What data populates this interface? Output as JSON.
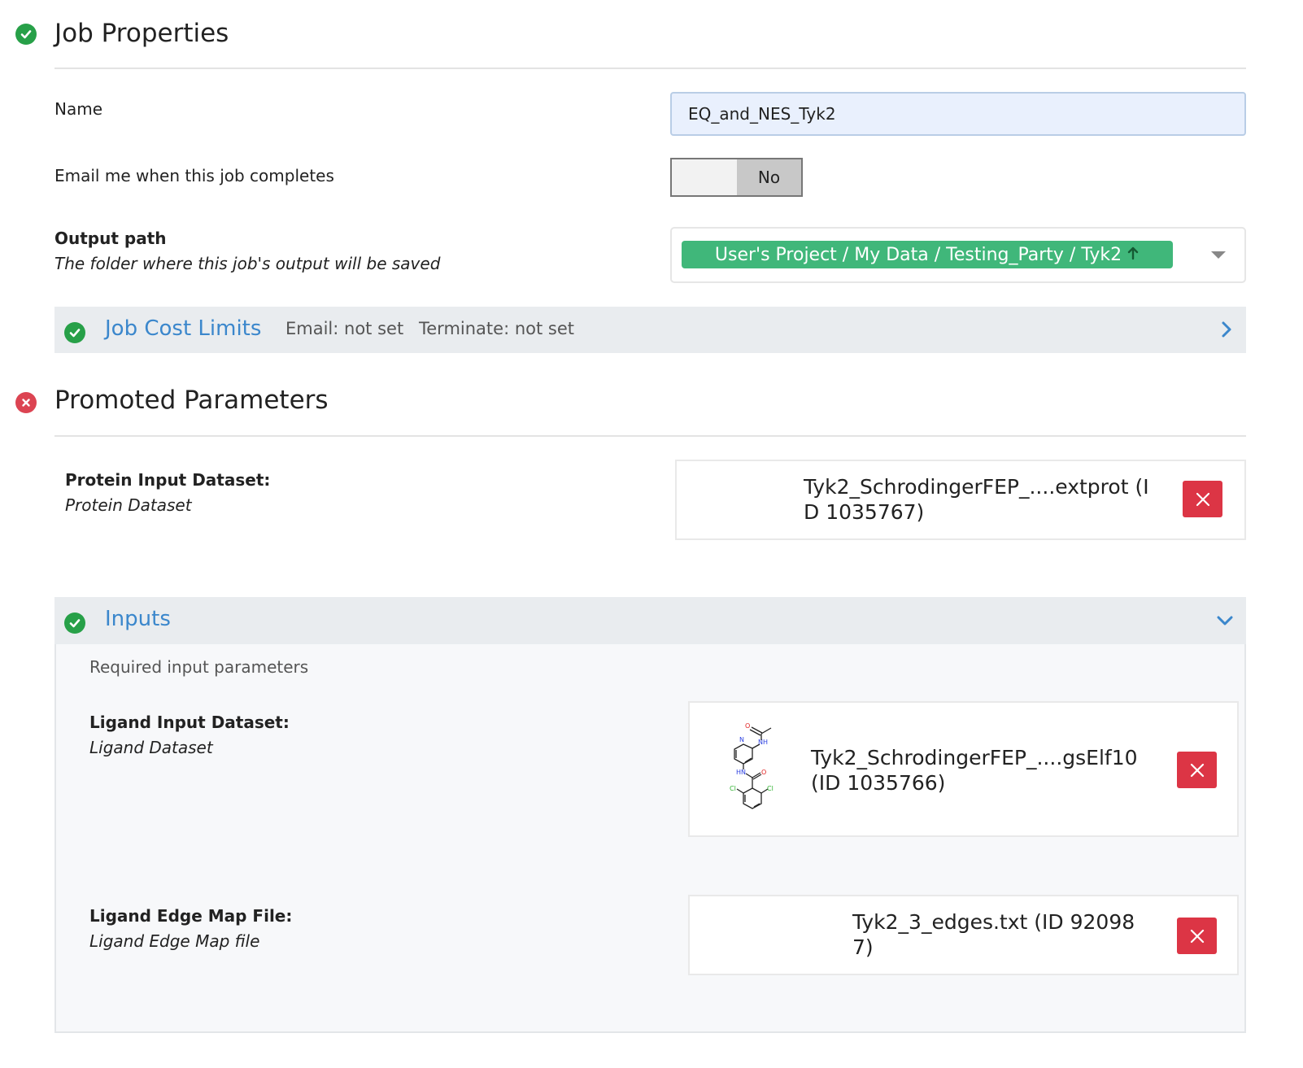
{
  "job_properties": {
    "title": "Job Properties",
    "name_label": "Name",
    "name_value": "EQ_and_NES_Tyk2",
    "email_label": "Email me when this job completes",
    "email_toggle": "No",
    "output_label": "Output path",
    "output_desc": "The folder where this job's output will be saved",
    "output_path": "User's Project / My Data / Testing_Party / Tyk2",
    "output_path_icon": "arrow-up-icon"
  },
  "cost_limits": {
    "title": "Job Cost Limits",
    "email": "Email: not set",
    "terminate": "Terminate: not set"
  },
  "promoted": {
    "title": "Promoted Parameters",
    "protein_label": "Protein Input Dataset:",
    "protein_desc": "Protein Dataset",
    "protein_value": "Tyk2_SchrodingerFEP_....extprot (ID 1035767)",
    "protein_value_l1": "Tyk2_SchrodingerFEP_....extprot (I",
    "protein_value_l2": "D 1035767)"
  },
  "inputs": {
    "title": "Inputs",
    "subtitle": "Required input parameters",
    "ligand_label": "Ligand Input Dataset:",
    "ligand_desc": "Ligand Dataset",
    "ligand_value": "Tyk2_SchrodingerFEP_....gsElf10 (ID 1035766)",
    "ligand_value_l1": "Tyk2_SchrodingerFEP_....gsElf10",
    "ligand_value_l2": "(ID 1035766)",
    "ligand_atoms": {
      "o": "O",
      "nh": "NH",
      "n": "N",
      "hn": "HN",
      "cl": "Cl"
    },
    "edge_label": "Ligand Edge Map File:",
    "edge_desc": "Ligand Edge Map file",
    "edge_value": "Tyk2_3_edges.txt (ID 920987)",
    "edge_value_l1": "Tyk2_3_edges.txt (ID 92098",
    "edge_value_l2": "7)"
  },
  "colors": {
    "success": "#27a048",
    "error": "#dc4452",
    "link": "#3b87cc",
    "path_pill": "#40b77a",
    "delete": "#dc3545"
  }
}
